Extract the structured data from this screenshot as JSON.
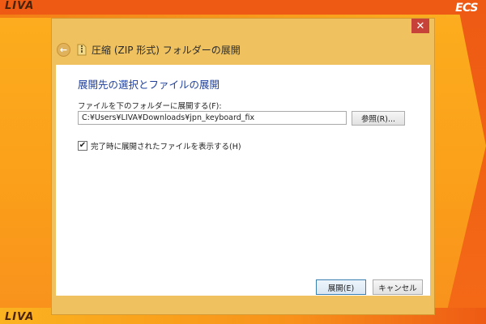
{
  "desktop": {
    "brand_left": "LIVA",
    "brand_right": "ECS"
  },
  "window": {
    "title": "圧縮 (ZIP 形式) フォルダーの展開",
    "close_glyph": "✕",
    "back_glyph": "←",
    "heading": "展開先の選択とファイルの展開",
    "path_label": "ファイルを下のフォルダーに展開する(F):",
    "path_value": "C:¥Users¥LIVA¥Downloads¥jpn_keyboard_fix",
    "browse_label": "参照(R)...",
    "show_files_checked": true,
    "show_files_check_glyph": "✔",
    "show_files_label": "完了時に展開されたファイルを表示する(H)",
    "extract_label": "展開(E)",
    "cancel_label": "キャンセル"
  },
  "colors": {
    "wallpaper": "#fba51a",
    "wallpaper_accent": "#ee5a14",
    "window_frame": "#efc25f",
    "close_button": "#c7433a",
    "heading_text": "#1e3f9c"
  }
}
